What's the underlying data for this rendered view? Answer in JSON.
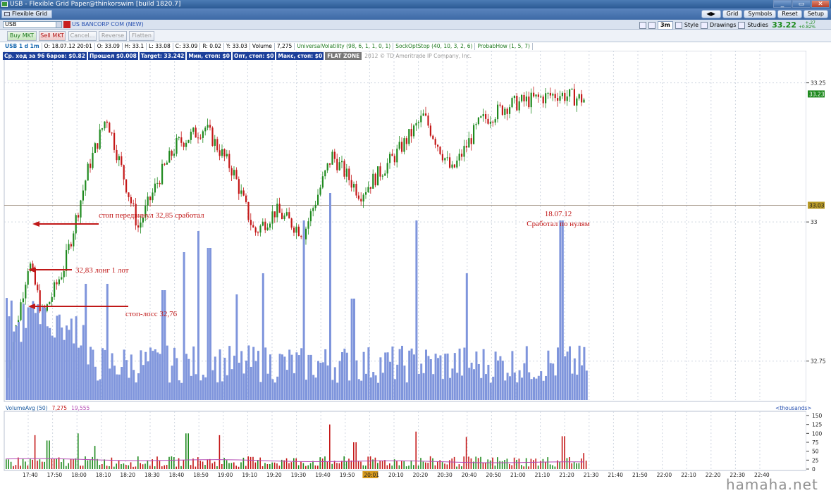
{
  "window": {
    "title": "USB - Flexible Grid Paper@thinkorswim [build 1820.7]",
    "controls": [
      "_",
      "▭",
      "✕"
    ]
  },
  "toolbar": {
    "tab_label": "Flexible Grid",
    "right_buttons": [
      "◀▶",
      "Grid",
      "Symbols",
      "Reset",
      "Setup"
    ]
  },
  "symbol_bar": {
    "symbol": "USB",
    "description": "US BANCORP COM (NEW)",
    "timeframe": "3m",
    "style": "Style",
    "drawings": "Drawings",
    "studies": "Studies",
    "last_price": "33.22",
    "change": "+.27",
    "change_pct": "+0.82%"
  },
  "trade_bar": {
    "buy": "Buy MKT",
    "sell": "Sell MKT",
    "cancel": "Cancel...",
    "reverse": "Reverse",
    "flatten": "Flatten"
  },
  "info": {
    "symbol": "USB 1 d 1m",
    "open": "O: 18.07.12 20:01",
    "o": "O: 33.09",
    "h": "H: 33.1",
    "l": "L: 33.08",
    "c": "C: 33.09",
    "r": "R: 0.02",
    "y": "Y: 33.03",
    "vol_lbl": "Volume",
    "vol": "7,275",
    "studies": [
      "UniversalVolatility (98, 6, 1, 1, 0, 1)",
      "SockOptStop (40, 10, 3, 2, 6)",
      "ProbabHow (1, 5, 7)"
    ]
  },
  "stats": [
    "Ср. ход за 96 баров: $0.82",
    "Прошел $0.008",
    "Target: 33.242",
    "Мин, стоп: $0",
    "Опт, стоп: $0",
    "Макс, стоп: $0"
  ],
  "flat_zone": "FLAT ZONE",
  "copyright": "2012 © TD Ameritrade IP Company, Inc.",
  "annotations": {
    "stop_moved": "стоп передвинул 32,85 сработал",
    "long": "32,83 лонг 1 лот",
    "stop_loss": "стоп-лосс 32,76",
    "date": "18.07.12",
    "result": "Сработал по нулям"
  },
  "volume_panel": {
    "label": "VolumeAvg (50)",
    "v1": "7,275",
    "v2": "19,555",
    "units": "<thousands>"
  },
  "watermark": "hamaha.net",
  "chart_data": {
    "type": "candlestick",
    "price_axis": {
      "ticks": [
        "33.25",
        "33",
        "32.75"
      ],
      "marker_last": "33.23",
      "marker_ref": "33.03"
    },
    "volume_axis": {
      "ticks": [
        "150",
        "125",
        "100",
        "75",
        "50",
        "25",
        "0"
      ]
    },
    "time_ticks": [
      "17:40",
      "17:50",
      "18:00",
      "18:10",
      "18:20",
      "18:30",
      "18:40",
      "18:50",
      "19:00",
      "19:10",
      "19:20",
      "19:30",
      "19:40",
      "19:50",
      "20:01",
      "20:10",
      "20:20",
      "20:30",
      "20:40",
      "20:50",
      "21:00",
      "21:10",
      "21:20",
      "21:30",
      "21:40",
      "21:50",
      "22:00",
      "22:10",
      "22:20",
      "22:30",
      "22:40"
    ],
    "ylim": [
      32.68,
      33.29
    ],
    "colors": {
      "up": "#1f8a1f",
      "down": "#c41818",
      "volume": "#7f95dc",
      "volume_avg": "#b44bb4",
      "arrow": "#c01818"
    }
  }
}
